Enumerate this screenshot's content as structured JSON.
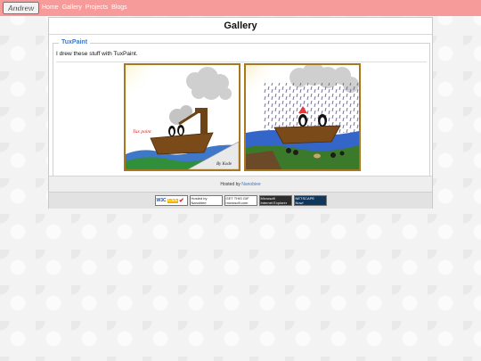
{
  "site": {
    "logo_text": "Andrew"
  },
  "nav": {
    "items": [
      "Home",
      "Gallery",
      "Projects",
      "Blogs"
    ]
  },
  "page": {
    "title": "Gallery"
  },
  "section": {
    "legend": "TuxPaint",
    "description": "I drew these stuff with TuxPaint."
  },
  "drawings": [
    {
      "name": "tux-paint-boat-drawing",
      "caption_text": "Tux paint",
      "signature": "By Kode"
    },
    {
      "name": "penguins-rain-boat-drawing"
    }
  ],
  "footer": {
    "hosted_prefix": "Hosted by",
    "hosted_link": "Nanobiee"
  },
  "badges": [
    {
      "name": "w3c-css-badge",
      "left": "W3C",
      "mid": "CSS",
      "mark": "✔"
    },
    {
      "name": "hosted-by-badge",
      "line1": "Hosted by",
      "line2": "Nanobiee"
    },
    {
      "name": "get-this-gif-badge",
      "line1": "GET THIS GIF",
      "line2": "microsoft.com"
    },
    {
      "name": "microsoft-ie-badge",
      "line1": "Microsoft",
      "line2": "Internet Explorer"
    },
    {
      "name": "netscape-badge",
      "line1": "NETSCAPE",
      "line2": "Now!"
    }
  ]
}
